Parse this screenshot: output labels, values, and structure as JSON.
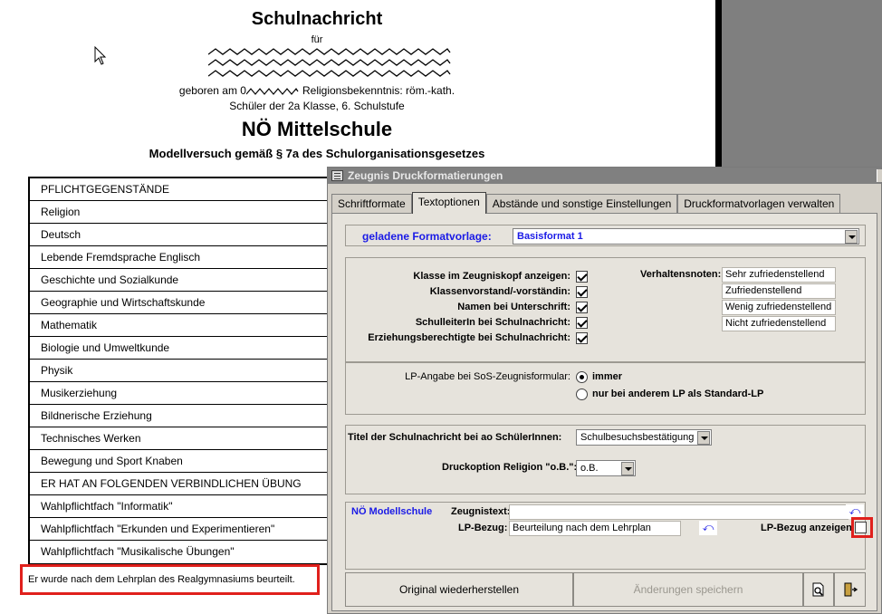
{
  "document": {
    "title": "Schulnachricht",
    "fuer": "für",
    "birth_prefix": "geboren am 0",
    "religion": "Religionsbekenntnis: röm.-kath.",
    "class_line": "Schüler der 2a Klasse, 6. Schulstufe",
    "school": "NÖ Mittelschule",
    "model": "Modellversuch gemäß § 7a des Schulorganisationsgesetzes",
    "subjects": [
      "PFLICHTGEGENSTÄNDE",
      "Religion",
      "Deutsch",
      "Lebende Fremdsprache Englisch",
      "Geschichte und Sozialkunde",
      "Geographie und Wirtschaftskunde",
      "Mathematik",
      "Biologie und Umweltkunde",
      "Physik",
      "Musikerziehung",
      "Bildnerische Erziehung",
      "Technisches Werken",
      "Bewegung und Sport Knaben",
      "ER HAT AN FOLGENDEN VERBINDLICHEN ÜBUNG",
      "Wahlpflichtfach \"Informatik\"",
      "Wahlpflichtfach \"Erkunden und Experimentieren\"",
      "Wahlpflichtfach \"Musikalische Übungen\""
    ],
    "note": "Er wurde nach dem Lehrplan des Realgymnasiums beurteilt."
  },
  "dialog": {
    "title": "Zeugnis Druckformatierungen",
    "tabs": [
      {
        "label": "Schriftformate",
        "active": false
      },
      {
        "label": "Textoptionen",
        "active": true
      },
      {
        "label": "Abstände und sonstige Einstellungen",
        "active": false
      },
      {
        "label": "Druckformatvorlagen verwalten",
        "active": false
      }
    ],
    "template_label": "geladene Formatvorlage:",
    "template_value": "Basisformat 1",
    "checkboxes": [
      {
        "label": "Klasse im Zeugniskopf anzeigen:",
        "checked": true
      },
      {
        "label": "Klassenvorstand/-vorständin:",
        "checked": true
      },
      {
        "label": "Namen bei Unterschrift:",
        "checked": true
      },
      {
        "label": "SchulleiterIn bei Schulnachricht:",
        "checked": true
      },
      {
        "label": "Erziehungsberechtigte bei Schulnachricht:",
        "checked": true
      }
    ],
    "behavior_label": "Verhaltensnoten:",
    "behavior_grades": [
      "Sehr zufriedenstellend",
      "Zufriedenstellend",
      "Wenig zufriedenstellend",
      "Nicht zufriedenstellend"
    ],
    "lp_label": "LP-Angabe bei SoS-Zeugnisformular:",
    "lp_options": [
      {
        "label": "immer",
        "selected": true
      },
      {
        "label": "nur bei anderem LP als Standard-LP",
        "selected": false
      }
    ],
    "title_label": "Titel der Schulnachricht bei ao SchülerInnen:",
    "title_value": "Schulbesuchsbestätigung",
    "religion_label": "Druckoption Religion \"o.B.\":",
    "religion_value": "o.B.",
    "modell_label": "NÖ Modellschule",
    "zeugnistext_label": "Zeugnistext:",
    "zeugnistext_value": "",
    "lpbezug_label": "LP-Bezug:",
    "lpbezug_value": "Beurteilung nach dem Lehrplan",
    "lpbezug_show_label": "LP-Bezug anzeigen",
    "lpbezug_show_checked": false,
    "undo_glyph": "⤺",
    "buttons": {
      "restore": "Original wiederherstellen",
      "save": "Änderungen speichern"
    },
    "colors": {
      "accent_blue": "#1a1ae6",
      "highlight_red": "#e0201c"
    }
  }
}
